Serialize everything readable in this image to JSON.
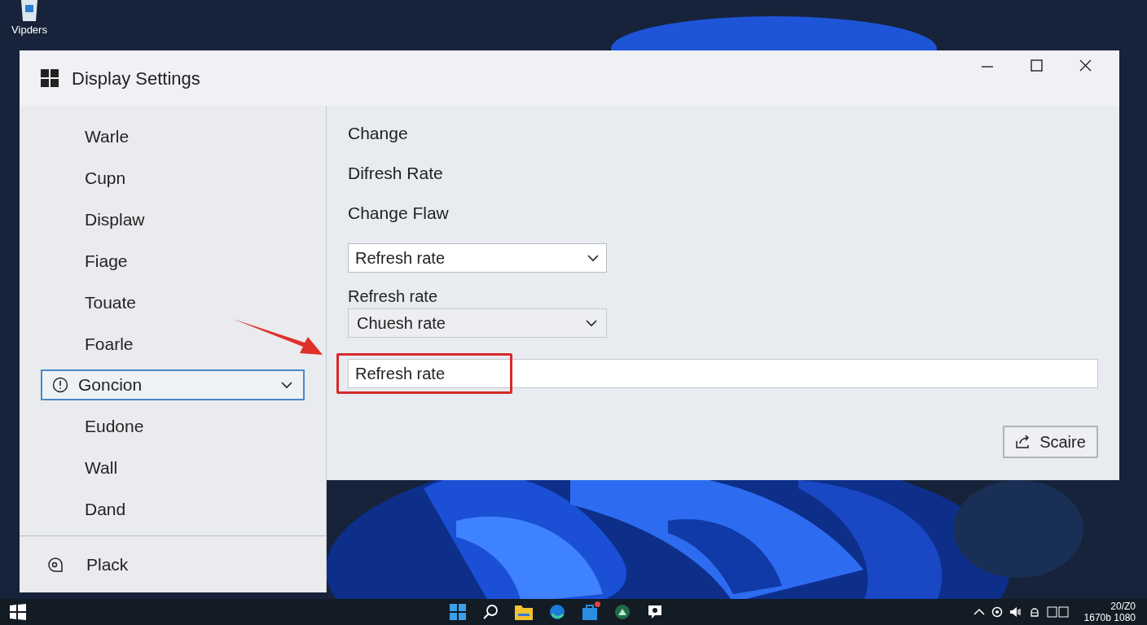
{
  "desktop": {
    "icons": [
      {
        "label": "Vipders"
      }
    ]
  },
  "window": {
    "title": "Display Settings"
  },
  "sidebar": {
    "items": [
      {
        "kind": "item",
        "label": "Warle",
        "selected": false
      },
      {
        "kind": "item",
        "label": "Cupn",
        "selected": false
      },
      {
        "kind": "item",
        "label": "Displaw",
        "selected": false
      },
      {
        "kind": "item",
        "label": "Fiage",
        "selected": false
      },
      {
        "kind": "item",
        "label": "Touate",
        "selected": false
      },
      {
        "kind": "item",
        "label": "Foarle",
        "selected": false
      },
      {
        "kind": "dropdown",
        "label": "Goncion",
        "selected": true
      },
      {
        "kind": "item",
        "label": "Eudone",
        "selected": false
      },
      {
        "kind": "item",
        "label": "Wall",
        "selected": false
      },
      {
        "kind": "item",
        "label": "Dand",
        "selected": false
      }
    ],
    "footer": {
      "label": "Plack"
    }
  },
  "content": {
    "headings": [
      "Change",
      "Difresh Rate",
      "Change Flaw"
    ],
    "dropdown_1": {
      "value": "Refresh rate"
    },
    "label": "Refresh rate",
    "dropdown_2": {
      "value": "Chuesh rate"
    },
    "text_field": {
      "value": "Refresh rate",
      "highlighted": true
    },
    "button": "Scaire"
  },
  "taskbar": {
    "clock": {
      "line_1": "20/Z0",
      "line_2": "1670b 1080"
    }
  }
}
